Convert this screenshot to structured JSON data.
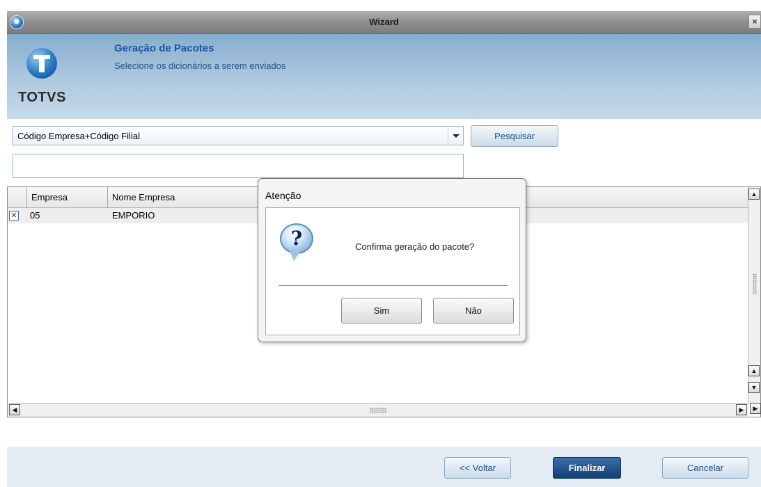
{
  "window": {
    "title": "Wizard",
    "close_glyph": "×"
  },
  "header": {
    "logo_text": "TOTVS",
    "title": "Geração de Pacotes",
    "subtitle": "Selecione os dicionários a serem enviados"
  },
  "search": {
    "combo_value": "Código Empresa+Código Filial",
    "search_button": "Pesquisar",
    "input_value": ""
  },
  "grid": {
    "columns": [
      "Empresa",
      "Nome Empresa"
    ],
    "rows": [
      {
        "checked": true,
        "check_glyph": "✕",
        "empresa": "05",
        "nome": "EMPORIO"
      }
    ]
  },
  "footer": {
    "back_button": "<< Voltar",
    "finish_button": "Finalizar",
    "cancel_button": "Cancelar"
  },
  "dialog": {
    "title": "Atenção",
    "icon_glyph": "?",
    "message": "Confirma geração do pacote?",
    "yes_button": "Sim",
    "no_button": "Não"
  },
  "colors": {
    "header_title": "#1b58a3",
    "finish_bg": "#123f75",
    "footer_bg": "#e3ecf5"
  }
}
